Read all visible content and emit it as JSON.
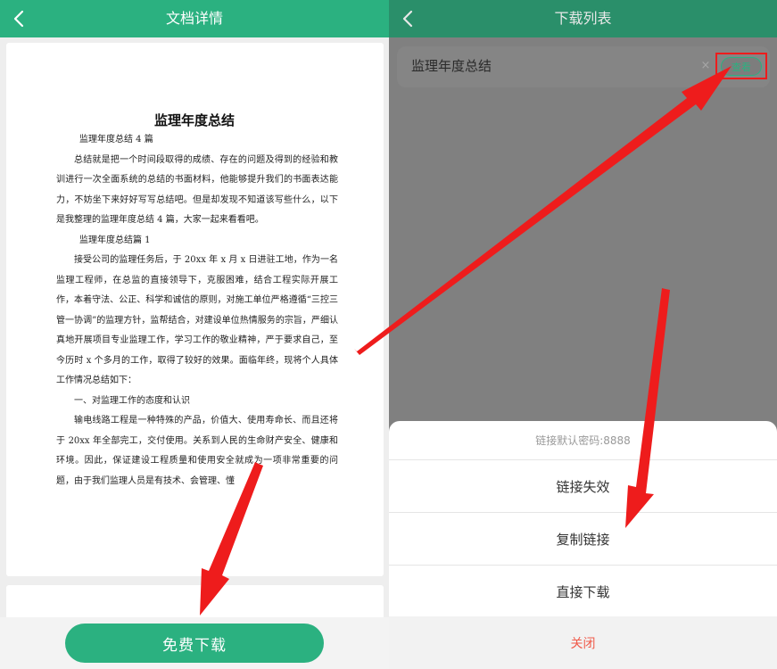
{
  "left": {
    "header_title": "文档详情",
    "doc_title": "监理年度总结",
    "doc_paragraphs": [
      {
        "text": "监理年度总结 4 篇",
        "style": "sub"
      },
      {
        "text": "总结就是把一个时间段取得的成绩、存在的问题及得到的经验和教训进行一次全面系统的总结的书面材料，他能够提升我们的书面表达能力，不妨坐下来好好写写总结吧。但是却发现不知道该写些什么，以下是我整理的监理年度总结 4 篇，大家一起来看看吧。",
        "style": "ind"
      },
      {
        "text": "监理年度总结篇 1",
        "style": "sub"
      },
      {
        "text": "接受公司的监理任务后，于 20xx 年 x 月 x 日进驻工地，作为一名监理工程师，在总监的直接领导下，克服困难，结合工程实际开展工作，本着守法、公正、科学和诚信的原则，对施工单位严格遵循“三控三管一协调”的监理方针，监帮结合，对建设单位热情服务的宗旨，严细认真地开展项目专业监理工作，学习工作的敬业精神，严于要求自己，至今历时 x 个多月的工作，取得了较好的效果。面临年终，现将个人具体工作情况总结如下：",
        "style": "ind"
      },
      {
        "text": "一、对监理工作的态度和认识",
        "style": "ind"
      },
      {
        "text": "输电线路工程是一种特殊的产品，价值大、使用寿命长、而且还将于 20xx 年全部完工，交付使用。关系到人民的生命财产安全、健康和环境。因此，保证建设工程质量和使用安全就成为一项非常重要的问题，由于我们监理人员是有技术、会管理、懂",
        "style": "ind"
      }
    ],
    "download_button": "免费下载"
  },
  "right": {
    "header_title": "下载列表",
    "item": {
      "name": "监理年度总结",
      "remove_glyph": "×",
      "view_button": "查看"
    },
    "sheet": {
      "password_hint": "链接默认密码:8888",
      "options": [
        "链接失效",
        "复制链接",
        "直接下载"
      ],
      "close": "关闭"
    }
  },
  "colors": {
    "brand_green": "#2bb180",
    "arrow_red": "#ee1c1c",
    "close_red": "#f05a4a"
  },
  "icons": {
    "back": "chevron-left-icon"
  }
}
